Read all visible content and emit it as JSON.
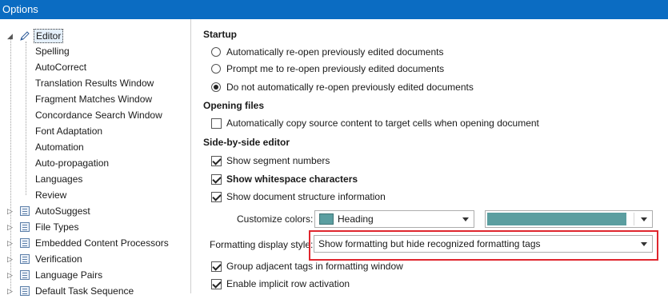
{
  "window": {
    "title": "Options"
  },
  "tree": {
    "editor": "Editor",
    "editor_children": [
      "Spelling",
      "AutoCorrect",
      "Translation Results Window",
      "Fragment Matches Window",
      "Concordance Search Window",
      "Font Adaptation",
      "Automation",
      "Auto-propagation",
      "Languages",
      "Review"
    ],
    "top_nodes": [
      "AutoSuggest",
      "File Types",
      "Embedded Content Processors",
      "Verification",
      "Language Pairs",
      "Default Task Sequence"
    ]
  },
  "startup": {
    "title": "Startup",
    "options": [
      {
        "label": "Automatically re-open previously edited documents",
        "selected": false
      },
      {
        "label": "Prompt me to re-open previously edited documents",
        "selected": false
      },
      {
        "label": "Do not automatically re-open previously edited documents",
        "selected": true
      }
    ]
  },
  "opening_files": {
    "title": "Opening files",
    "copy_source": {
      "label": "Automatically copy source content to target cells when opening document",
      "checked": false
    }
  },
  "side_by_side": {
    "title": "Side-by-side editor",
    "options": [
      {
        "label": "Show segment numbers",
        "checked": true,
        "bold": false
      },
      {
        "label": "Show whitespace characters",
        "checked": true,
        "bold": true
      },
      {
        "label": "Show document structure information",
        "checked": true,
        "bold": false
      }
    ],
    "customize_colors_label": "Customize colors:",
    "customize_colors_value": "Heading",
    "color_swatch": "#5b9ea0",
    "formatting_style_label": "Formatting display style:",
    "formatting_style_value": "Show formatting but hide recognized formatting tags",
    "group_tags": {
      "label": "Group adjacent tags in formatting window",
      "checked": true
    },
    "implicit_row": {
      "label": "Enable implicit row activation",
      "checked": true
    }
  },
  "colors": {
    "titlebar": "#0b6cc2",
    "highlight": "#e0262e"
  }
}
